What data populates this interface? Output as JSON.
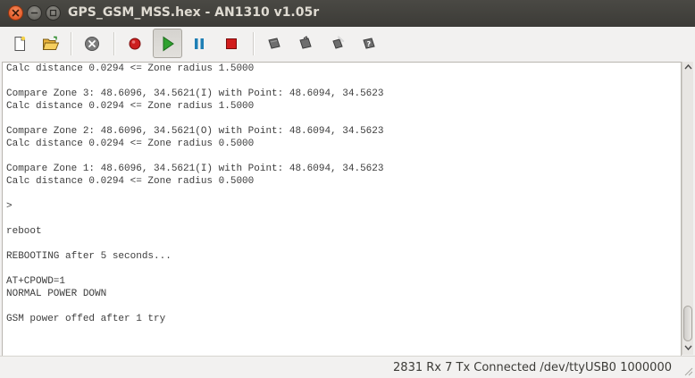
{
  "window": {
    "title": "GPS_GSM_MSS.hex - AN1310 v1.05r"
  },
  "toolbar": {
    "buttons": [
      {
        "name": "new-file-button",
        "icon": "new-document-icon"
      },
      {
        "name": "open-file-button",
        "icon": "open-folder-icon"
      },
      {
        "name": "abort-button",
        "icon": "cancel-icon"
      },
      {
        "name": "record-button",
        "icon": "record-icon",
        "color": "#cc1f1f"
      },
      {
        "name": "run-button",
        "icon": "play-icon",
        "color": "#2fa12f",
        "pressed": true
      },
      {
        "name": "pause-button",
        "icon": "pause-icon",
        "color": "#1f7fb5"
      },
      {
        "name": "stop-button",
        "icon": "stop-icon",
        "color": "#d11c1c"
      },
      {
        "name": "read-device-button",
        "icon": "chip-read-icon"
      },
      {
        "name": "write-device-button",
        "icon": "chip-write-icon"
      },
      {
        "name": "erase-device-button",
        "icon": "chip-erase-icon"
      },
      {
        "name": "verify-device-button",
        "icon": "chip-verify-icon"
      }
    ]
  },
  "console": {
    "lines": [
      "Calc distance 0.0294 <= Zone radius 1.5000",
      "",
      "Compare Zone 3: 48.6096, 34.5621(I) with Point: 48.6094, 34.5623",
      "Calc distance 0.0294 <= Zone radius 1.5000",
      "",
      "Compare Zone 2: 48.6096, 34.5621(O) with Point: 48.6094, 34.5623",
      "Calc distance 0.0294 <= Zone radius 0.5000",
      "",
      "Compare Zone 1: 48.6096, 34.5621(I) with Point: 48.6094, 34.5623",
      "Calc distance 0.0294 <= Zone radius 0.5000",
      "",
      ">",
      "",
      "reboot",
      "",
      "REBOOTING after 5 seconds...",
      "",
      "AT+CPOWD=1",
      "NORMAL POWER DOWN",
      "",
      "GSM power offed after 1 try"
    ]
  },
  "statusbar": {
    "text": "2831 Rx 7 Tx  Connected  /dev/ttyUSB0  1000000"
  }
}
